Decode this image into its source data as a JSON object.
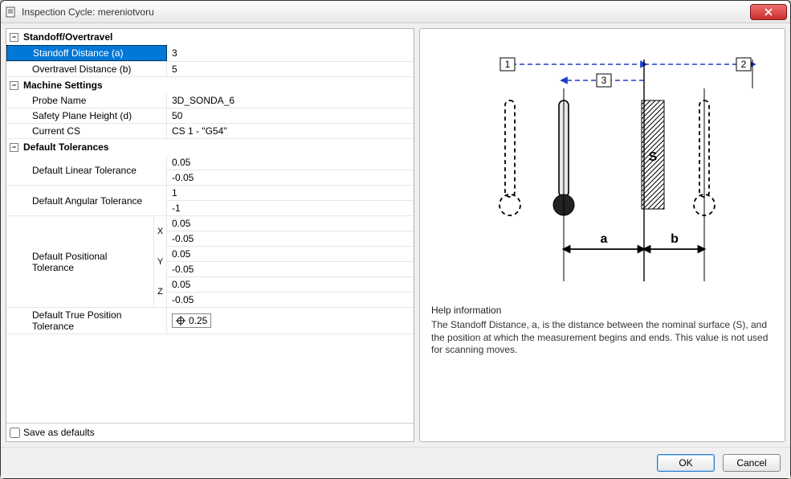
{
  "window": {
    "title": "Inspection Cycle: mereniotvoru"
  },
  "groups": {
    "standoff": {
      "header": "Standoff/Overtravel",
      "standoff_label": "Standoff Distance (a)",
      "standoff_value": "3",
      "overtravel_label": "Overtravel Distance (b)",
      "overtravel_value": "5"
    },
    "machine": {
      "header": "Machine Settings",
      "probe_label": "Probe Name",
      "probe_value": "3D_SONDA_6",
      "safety_label": "Safety Plane Height (d)",
      "safety_value": "50",
      "cs_label": "Current CS",
      "cs_value": "CS 1 - \"G54\""
    },
    "tol": {
      "header": "Default Tolerances",
      "linear_label": "Default Linear Tolerance",
      "linear_upper": "0.05",
      "linear_lower": "-0.05",
      "angular_label": "Default Angular Tolerance",
      "angular_upper": "1",
      "angular_lower": "-1",
      "positional_label": "Default Positional Tolerance",
      "pos_x_upper": "0.05",
      "pos_x_lower": "-0.05",
      "pos_y_upper": "0.05",
      "pos_y_lower": "-0.05",
      "pos_z_upper": "0.05",
      "pos_z_lower": "-0.05",
      "tp_label": "Default True Position Tolerance",
      "tp_value": "0.25"
    }
  },
  "save_defaults_label": "Save as defaults",
  "diagram": {
    "marker1": "1",
    "marker2": "2",
    "marker3": "3",
    "a": "a",
    "b": "b",
    "s": "S"
  },
  "help": {
    "title": "Help information",
    "text": "The Standoff Distance, a, is the distance between the nominal surface (S), and the position at which the measurement begins and ends. This value is not used for scanning moves."
  },
  "buttons": {
    "ok": "OK",
    "cancel": "Cancel"
  }
}
